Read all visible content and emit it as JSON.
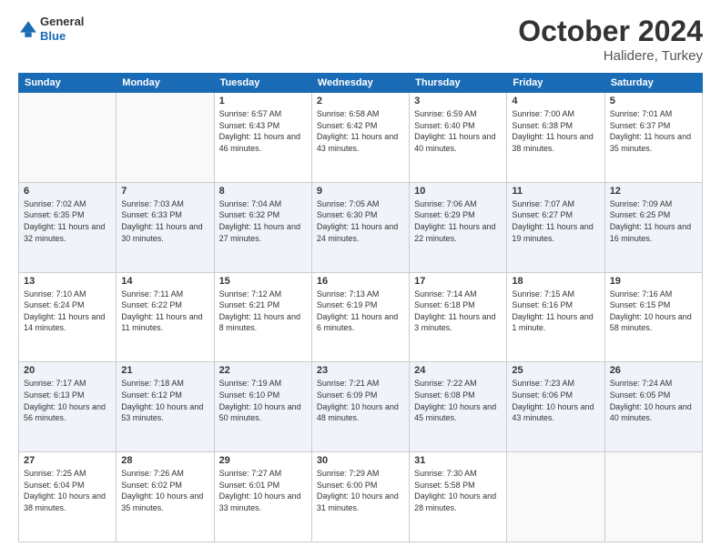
{
  "header": {
    "logo_general": "General",
    "logo_blue": "Blue",
    "month": "October 2024",
    "location": "Halidere, Turkey"
  },
  "weekdays": [
    "Sunday",
    "Monday",
    "Tuesday",
    "Wednesday",
    "Thursday",
    "Friday",
    "Saturday"
  ],
  "weeks": [
    [
      {
        "day": "",
        "info": ""
      },
      {
        "day": "",
        "info": ""
      },
      {
        "day": "1",
        "info": "Sunrise: 6:57 AM\nSunset: 6:43 PM\nDaylight: 11 hours and 46 minutes."
      },
      {
        "day": "2",
        "info": "Sunrise: 6:58 AM\nSunset: 6:42 PM\nDaylight: 11 hours and 43 minutes."
      },
      {
        "day": "3",
        "info": "Sunrise: 6:59 AM\nSunset: 6:40 PM\nDaylight: 11 hours and 40 minutes."
      },
      {
        "day": "4",
        "info": "Sunrise: 7:00 AM\nSunset: 6:38 PM\nDaylight: 11 hours and 38 minutes."
      },
      {
        "day": "5",
        "info": "Sunrise: 7:01 AM\nSunset: 6:37 PM\nDaylight: 11 hours and 35 minutes."
      }
    ],
    [
      {
        "day": "6",
        "info": "Sunrise: 7:02 AM\nSunset: 6:35 PM\nDaylight: 11 hours and 32 minutes."
      },
      {
        "day": "7",
        "info": "Sunrise: 7:03 AM\nSunset: 6:33 PM\nDaylight: 11 hours and 30 minutes."
      },
      {
        "day": "8",
        "info": "Sunrise: 7:04 AM\nSunset: 6:32 PM\nDaylight: 11 hours and 27 minutes."
      },
      {
        "day": "9",
        "info": "Sunrise: 7:05 AM\nSunset: 6:30 PM\nDaylight: 11 hours and 24 minutes."
      },
      {
        "day": "10",
        "info": "Sunrise: 7:06 AM\nSunset: 6:29 PM\nDaylight: 11 hours and 22 minutes."
      },
      {
        "day": "11",
        "info": "Sunrise: 7:07 AM\nSunset: 6:27 PM\nDaylight: 11 hours and 19 minutes."
      },
      {
        "day": "12",
        "info": "Sunrise: 7:09 AM\nSunset: 6:25 PM\nDaylight: 11 hours and 16 minutes."
      }
    ],
    [
      {
        "day": "13",
        "info": "Sunrise: 7:10 AM\nSunset: 6:24 PM\nDaylight: 11 hours and 14 minutes."
      },
      {
        "day": "14",
        "info": "Sunrise: 7:11 AM\nSunset: 6:22 PM\nDaylight: 11 hours and 11 minutes."
      },
      {
        "day": "15",
        "info": "Sunrise: 7:12 AM\nSunset: 6:21 PM\nDaylight: 11 hours and 8 minutes."
      },
      {
        "day": "16",
        "info": "Sunrise: 7:13 AM\nSunset: 6:19 PM\nDaylight: 11 hours and 6 minutes."
      },
      {
        "day": "17",
        "info": "Sunrise: 7:14 AM\nSunset: 6:18 PM\nDaylight: 11 hours and 3 minutes."
      },
      {
        "day": "18",
        "info": "Sunrise: 7:15 AM\nSunset: 6:16 PM\nDaylight: 11 hours and 1 minute."
      },
      {
        "day": "19",
        "info": "Sunrise: 7:16 AM\nSunset: 6:15 PM\nDaylight: 10 hours and 58 minutes."
      }
    ],
    [
      {
        "day": "20",
        "info": "Sunrise: 7:17 AM\nSunset: 6:13 PM\nDaylight: 10 hours and 56 minutes."
      },
      {
        "day": "21",
        "info": "Sunrise: 7:18 AM\nSunset: 6:12 PM\nDaylight: 10 hours and 53 minutes."
      },
      {
        "day": "22",
        "info": "Sunrise: 7:19 AM\nSunset: 6:10 PM\nDaylight: 10 hours and 50 minutes."
      },
      {
        "day": "23",
        "info": "Sunrise: 7:21 AM\nSunset: 6:09 PM\nDaylight: 10 hours and 48 minutes."
      },
      {
        "day": "24",
        "info": "Sunrise: 7:22 AM\nSunset: 6:08 PM\nDaylight: 10 hours and 45 minutes."
      },
      {
        "day": "25",
        "info": "Sunrise: 7:23 AM\nSunset: 6:06 PM\nDaylight: 10 hours and 43 minutes."
      },
      {
        "day": "26",
        "info": "Sunrise: 7:24 AM\nSunset: 6:05 PM\nDaylight: 10 hours and 40 minutes."
      }
    ],
    [
      {
        "day": "27",
        "info": "Sunrise: 7:25 AM\nSunset: 6:04 PM\nDaylight: 10 hours and 38 minutes."
      },
      {
        "day": "28",
        "info": "Sunrise: 7:26 AM\nSunset: 6:02 PM\nDaylight: 10 hours and 35 minutes."
      },
      {
        "day": "29",
        "info": "Sunrise: 7:27 AM\nSunset: 6:01 PM\nDaylight: 10 hours and 33 minutes."
      },
      {
        "day": "30",
        "info": "Sunrise: 7:29 AM\nSunset: 6:00 PM\nDaylight: 10 hours and 31 minutes."
      },
      {
        "day": "31",
        "info": "Sunrise: 7:30 AM\nSunset: 5:58 PM\nDaylight: 10 hours and 28 minutes."
      },
      {
        "day": "",
        "info": ""
      },
      {
        "day": "",
        "info": ""
      }
    ]
  ]
}
